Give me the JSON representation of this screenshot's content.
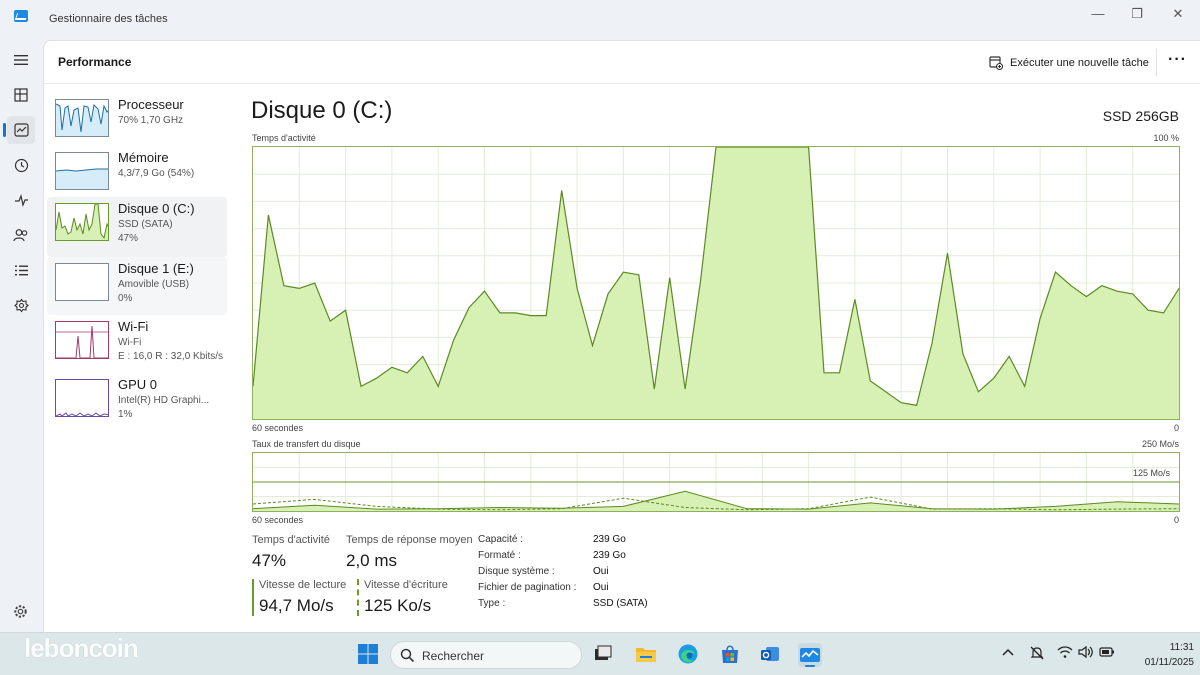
{
  "window": {
    "title": "Gestionnaire des tâches",
    "minimize": "—",
    "maximize": "❐",
    "close": "✕"
  },
  "header": {
    "title": "Performance",
    "new_task_label": "Exécuter une nouvelle tâche",
    "more": "···"
  },
  "resources": [
    {
      "name": "Processeur",
      "sub1": "70%  1,70 GHz",
      "sub2": "",
      "sub3": ""
    },
    {
      "name": "Mémoire",
      "sub1": "4,3/7,9 Go (54%)",
      "sub2": "",
      "sub3": ""
    },
    {
      "name": "Disque 0 (C:)",
      "sub1": "SSD (SATA)",
      "sub2": "47%",
      "sub3": ""
    },
    {
      "name": "Disque 1 (E:)",
      "sub1": "Amovible (USB)",
      "sub2": "0%",
      "sub3": ""
    },
    {
      "name": "Wi-Fi",
      "sub1": "Wi-Fi",
      "sub2": "E : 16,0  R : 32,0 Kbits/s",
      "sub3": ""
    },
    {
      "name": "GPU 0",
      "sub1": "Intel(R) HD Graphi...",
      "sub2": "1%",
      "sub3": ""
    }
  ],
  "detail": {
    "title": "Disque 0 (C:)",
    "model": "SSD 256GB",
    "activity_graph": {
      "label": "Temps d'activité",
      "max_label": "100 %",
      "time_label": "60 secondes",
      "min_label": "0"
    },
    "transfer_graph": {
      "label": "Taux de transfert du disque",
      "max_label": "250 Mo/s",
      "mid_label": "125 Mo/s",
      "time_label": "60 secondes",
      "min_label": "0"
    },
    "stats": {
      "active_time_label": "Temps d'activité",
      "active_time": "47%",
      "response_label": "Temps de réponse moyen",
      "response": "2,0 ms",
      "read_label": "Vitesse de lecture",
      "read": "94,7 Mo/s",
      "write_label": "Vitesse d'écriture",
      "write": "125 Ko/s"
    },
    "properties": [
      {
        "key": "Capacité :",
        "value": "239 Go"
      },
      {
        "key": "Formaté :",
        "value": "239 Go"
      },
      {
        "key": "Disque système :",
        "value": "Oui"
      },
      {
        "key": "Fichier de pagination :",
        "value": "Oui"
      },
      {
        "key": "Type :",
        "value": "SSD (SATA)"
      }
    ]
  },
  "chart_data": [
    {
      "type": "area",
      "xlabel": "60 secondes",
      "ylim": [
        0,
        100
      ],
      "x": [
        60,
        59,
        58,
        57,
        56,
        55,
        54,
        53,
        52,
        51,
        50,
        49,
        48,
        47,
        46,
        45,
        44,
        43,
        42,
        41,
        40,
        39,
        38,
        37,
        36,
        35,
        34,
        33,
        32,
        31,
        30,
        29,
        28,
        27,
        26,
        25,
        24,
        23,
        22,
        21,
        20,
        19,
        18,
        17,
        16,
        15,
        14,
        13,
        12,
        11,
        10,
        9,
        8,
        7,
        6,
        5,
        4,
        3,
        2,
        1,
        0
      ],
      "series": [
        {
          "values": [
            12,
            75,
            49,
            48,
            50,
            36,
            40,
            12,
            15,
            19,
            17,
            23,
            12,
            29,
            41,
            47,
            39,
            39,
            38,
            38,
            84,
            48,
            27,
            46,
            54,
            53,
            11,
            52,
            11,
            51,
            100,
            100,
            100,
            100,
            100,
            100,
            100,
            17,
            17,
            44,
            14,
            10,
            6,
            5,
            28,
            61,
            24,
            10,
            15,
            23,
            12,
            37,
            54,
            49,
            45,
            49,
            47,
            46,
            40,
            39,
            48
          ]
        }
      ]
    },
    {
      "type": "line",
      "xlabel": "60 secondes",
      "ylim": [
        0,
        250
      ],
      "x": [
        60,
        56,
        52,
        48,
        44,
        40,
        36,
        32,
        28,
        24,
        20,
        16,
        12,
        8,
        4,
        0
      ],
      "series": [
        {
          "values": [
            10,
            25,
            8,
            10,
            15,
            12,
            20,
            85,
            10,
            8,
            35,
            10,
            8,
            20,
            40,
            30
          ]
        },
        {
          "values": [
            30,
            50,
            20,
            8,
            5,
            10,
            55,
            15,
            5,
            10,
            60,
            8,
            10,
            5,
            8,
            10
          ]
        }
      ]
    }
  ],
  "taskbar": {
    "search_placeholder": "Rechercher",
    "time": "11:31",
    "date": "01/11/2025",
    "brand": "leboncoin"
  },
  "colors": {
    "accent": "#1a73c7",
    "disk_green": "#6a9a2a",
    "disk_fill": "#d7f0b4"
  }
}
